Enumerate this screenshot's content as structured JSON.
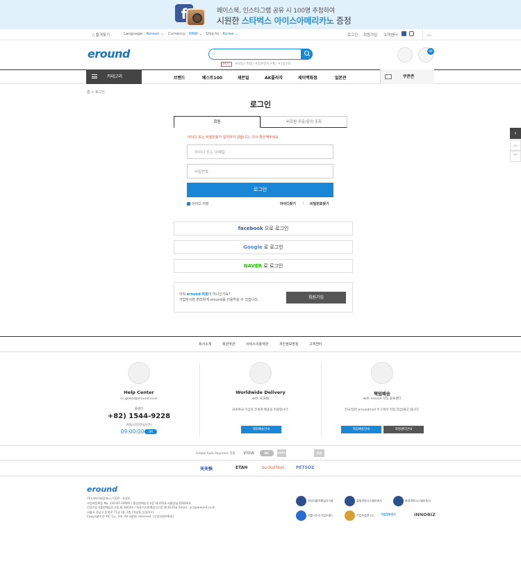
{
  "banner": {
    "line1": "페이스북, 인스타그램 공유 시 100명 추첨하여",
    "line2_a": "시원한 ",
    "line2_b": "스타벅스 아이스아메리카노",
    "line2_c": " 증정"
  },
  "util": {
    "bookmark": "즐겨찾기",
    "language_label": "Language :",
    "language": "Korean",
    "currency_label": "Currency :",
    "currency": "KRW",
    "ship_label": "Ship to :",
    "ship": "Korea",
    "login": "로그인",
    "join": "회원가입",
    "cs": "고객센터"
  },
  "header": {
    "logo": "eround",
    "hot": "HOT",
    "tag1": "#바캉스특템",
    "tag2": "#일본현지구매",
    "tag3": "#1일1책",
    "cart_count": "00"
  },
  "nav": {
    "category": "카테고리",
    "items": [
      "브랜드",
      "베스트100",
      "세븐일",
      "AK플라자",
      "세이백화점",
      "일본관"
    ],
    "coupon": "쿠폰존"
  },
  "breadcrumb": {
    "home": "홈",
    "sep": ">",
    "current": "로그인"
  },
  "login": {
    "title": "로그인",
    "tab_member": "회원",
    "tab_guest": "비회원 주문/문의 조회",
    "error": "아이디 또는 비밀번호가 일치하지 않습니다. 다시 확인해주세요.",
    "id_placeholder": "아이디 또는 이메일",
    "pw_placeholder": "비밀번호",
    "submit": "로그인",
    "keep": "아이디 저장",
    "find_id": "아이디찾기",
    "find_pw": "비밀번호찾기",
    "social_suffix": "으로 로그인",
    "social_suffix2": "로 로그인",
    "facebook": "facebook",
    "google": "Google",
    "naver": "NAVER",
    "join_line1_a": "아직 ",
    "join_line1_b": "eround 회원",
    "join_line1_c": "이 아니신가요?",
    "join_line2": "가입하시면 편리하게 eround를 이용하실 수 있습니다.",
    "join_button": "회원가입"
  },
  "footer": {
    "links": [
      "회사소개",
      "회원약관",
      "서비스이용약관",
      "개인정보방침",
      "고객센터"
    ],
    "help_title": "Help Center",
    "help_email": "cs_global@eround.co.kr",
    "help_phone_label": "콜센터",
    "help_phone": "+82) 1544-9228",
    "help_hours_label": "이용시간(한국시간)",
    "help_time": "09:00:00",
    "help_on": "ON",
    "wd_title": "Worldwide Delivery",
    "wd_sub": "with 天天快",
    "wd_desc": "200여국 이상의 전세계 배송을 지원합니다.",
    "wd_btn": "해외배송안내",
    "kr_title": "책임배송",
    "kr_sub": "with eround 직접 물류센터",
    "kr_desc": "한국/일본 eroundmall 이 C에서 직접 작업/출고 됩니다.",
    "kr_btn1": "책임배송안내",
    "kr_btn2": "직영센터안내",
    "pay_label": "Global Safe Payment 지원",
    "pay": [
      "VISA",
      "MC",
      "AMEX",
      "JCB"
    ],
    "partners": [
      "天天快",
      "ETAH",
      "bucketfeet",
      "PETSOZ"
    ],
    "logo": "eround",
    "info": [
      "(주)이아이씨컴퍼니 / CEO : 유상민",
      "사업자등록증 No. 120-87-24665 / 통신판매업신고증 제 2010-서울강남-02836호",
      "건강기능식품판매업신고증 제 3663호 / 의료기기판매업신고증 제 8125호 Email : ycr@eround.co.kr",
      "서울시 강남구 논현로 71길 18, 2층 (역삼동,신성하우)",
      "Copyright © YIC Co., Ltd. All rights reserved. [사업자정보확인]"
    ],
    "certs": [
      "전자지불이행업자기관",
      "품질경영시스템인증서",
      "환경경영시스템인증서",
      "서울시우수기업브랜드",
      "기업부설연구소",
      "기업정부연수",
      "INNOBIZ"
    ]
  }
}
